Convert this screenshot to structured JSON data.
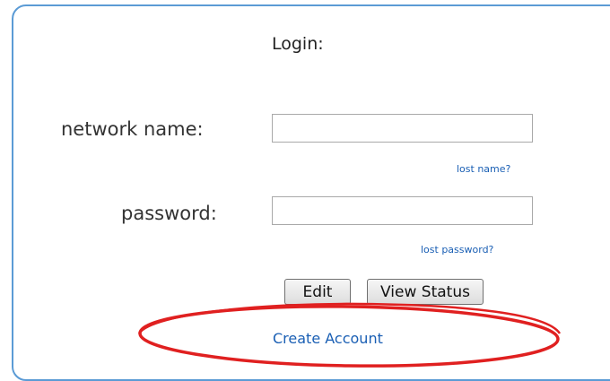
{
  "login": {
    "title": "Login:",
    "network_name_label": "network name:",
    "network_name_value": "",
    "lost_name_link": "lost name?",
    "password_label": "password:",
    "password_value": "",
    "lost_password_link": "lost password?",
    "edit_button": "Edit",
    "view_status_button": "View Status",
    "create_account_link": "Create Account"
  },
  "colors": {
    "panel_border": "#5b9bd5",
    "link": "#1a5fb4",
    "annotation": "#e02020"
  }
}
